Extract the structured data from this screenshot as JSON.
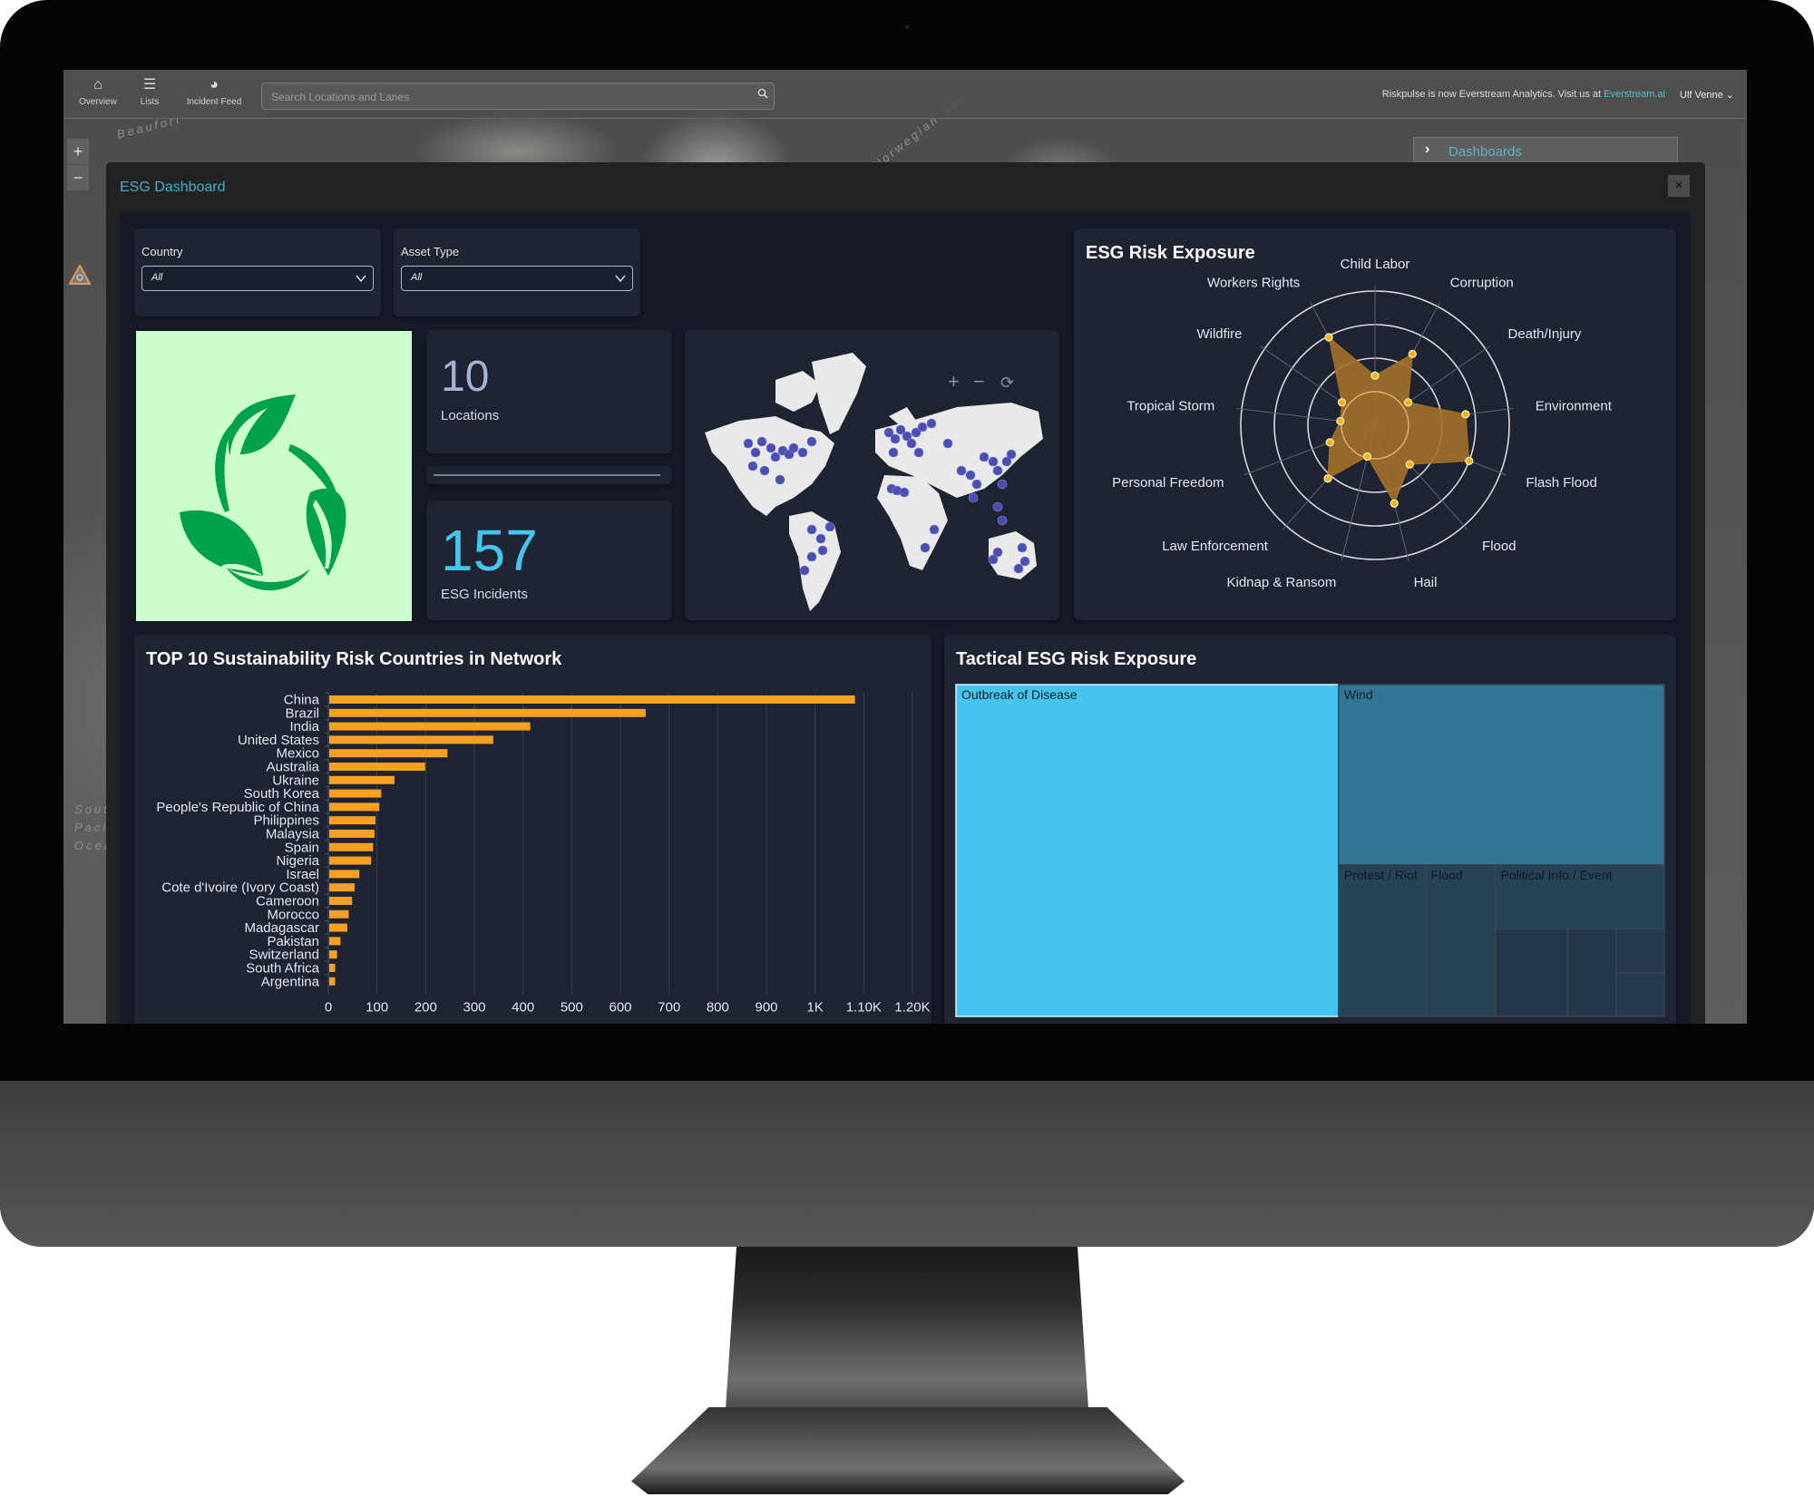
{
  "topbar": {
    "nav": [
      {
        "label": "Overview",
        "icon": "home-icon"
      },
      {
        "label": "Lists",
        "icon": "list-icon"
      },
      {
        "label": "Incident Feed",
        "icon": "globe-icon"
      }
    ],
    "search_placeholder": "Search Locations and Lanes",
    "notice_text": "Riskpulse is now Everstream Analytics. Visit us at ",
    "notice_link": "Everstream.ai",
    "user_name": "Ulf Venne"
  },
  "map_background": {
    "labels": [
      "Beaufort",
      "Norwegian Sea",
      "South Pacific Ocean"
    ],
    "zoom_in": "+",
    "zoom_out": "−",
    "dashboards_tab": "Dashboards"
  },
  "modal": {
    "title": "ESG Dashboard",
    "close": "×"
  },
  "filters": {
    "country": {
      "label": "Country",
      "value": "All"
    },
    "asset_type": {
      "label": "Asset Type",
      "value": "All"
    }
  },
  "kpis": {
    "locations": {
      "value": "10",
      "label": "Locations"
    },
    "incidents": {
      "value": "157",
      "label": "ESG Incidents"
    }
  },
  "map_widget": {
    "zoom_in": "+",
    "zoom_out": "−",
    "reset": "⟳"
  },
  "colors": {
    "accent": "#3fb0cc",
    "bar": "#f7a021",
    "radar_fill": "#a37028",
    "radar_point": "#f7b21f",
    "treemap_primary": "#45c4f0",
    "treemap_secondary": "#317694",
    "treemap_tertiary": "#274457",
    "kpi_incidents": "#45c4f0",
    "kpi_locations": "#a6b2d2"
  },
  "chart_data": [
    {
      "type": "radar",
      "title": "ESG Risk Exposure",
      "categories": [
        "Child Labor",
        "Corruption",
        "Death/Injury",
        "Environment",
        "Flash Flood",
        "Flood",
        "Hail",
        "Kidnap & Ransom",
        "Law Enforcement",
        "Personal Freedom",
        "Tropical Storm",
        "Wildfire",
        "Workers Rights"
      ],
      "values": [
        0.37,
        0.6,
        0.3,
        0.68,
        0.75,
        0.39,
        0.6,
        0.24,
        0.53,
        0.36,
        0.26,
        0.3,
        0.74
      ],
      "rlim": [
        0,
        1
      ],
      "rings": 4
    },
    {
      "type": "bar",
      "orientation": "horizontal",
      "title": "TOP 10 Sustainability Risk Countries in Network",
      "categories": [
        "China",
        "Brazil",
        "India",
        "United States",
        "Mexico",
        "Australia",
        "Ukraine",
        "South Korea",
        "People's Republic of China",
        "Philippines",
        "Malaysia",
        "Spain",
        "Nigeria",
        "Israel",
        "Cote d'Ivoire (Ivory Coast)",
        "Cameroon",
        "Morocco",
        "Madagascar",
        "Pakistan",
        "Switzerland",
        "South Africa",
        "Argentina"
      ],
      "values": [
        1080,
        650,
        413,
        337,
        243,
        197,
        134,
        107,
        103,
        95,
        93,
        90,
        86,
        62,
        52,
        47,
        40,
        37,
        23,
        16,
        12,
        12
      ],
      "xlim": [
        0,
        1200
      ],
      "xticks": [
        "0",
        "100",
        "200",
        "300",
        "400",
        "500",
        "600",
        "700",
        "800",
        "900",
        "1K",
        "1.10K",
        "1.20K"
      ],
      "grid": true
    },
    {
      "type": "treemap",
      "title": "Tactical ESG Risk Exposure",
      "items": [
        {
          "label": "Outbreak of Disease",
          "value": 54
        },
        {
          "label": "Wind",
          "value": 25
        },
        {
          "label": "Protest / Riot",
          "value": 5.6
        },
        {
          "label": "Flood",
          "value": 4.5
        },
        {
          "label": "Political Info / Event",
          "value": 4.6
        },
        {
          "label": "",
          "value": 2.7
        },
        {
          "label": "",
          "value": 1.8
        },
        {
          "label": "",
          "value": 0.9
        },
        {
          "label": "",
          "value": 0.9
        }
      ]
    }
  ]
}
